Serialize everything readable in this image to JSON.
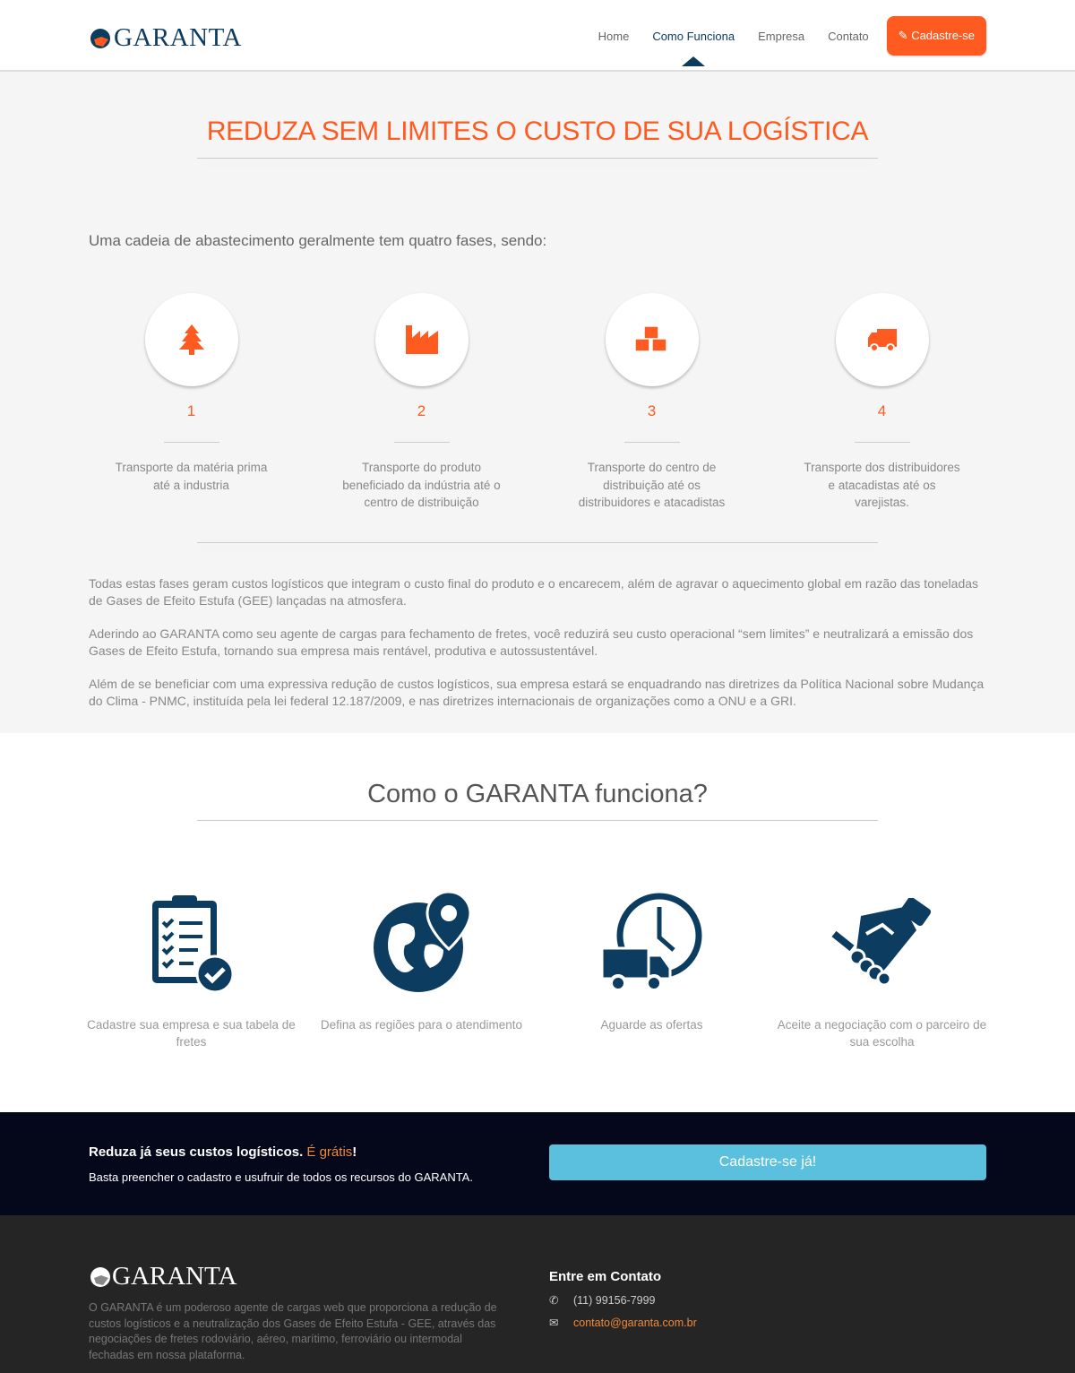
{
  "header": {
    "logo": "GARANTA",
    "nav": [
      "Home",
      "Como Funciona",
      "Empresa",
      "Contato"
    ],
    "active": "Como Funciona",
    "cta": "Cadastre-se"
  },
  "colors": {
    "accent": "#ff5a1f",
    "brand": "#0d3c61",
    "cta_button": "#5bc0de",
    "dark_band": "#05081a",
    "footer": "#252525"
  },
  "intro": {
    "title": "REDUZA SEM LIMITES O CUSTO DE SUA LOGÍSTICA",
    "lead": "Uma cadeia de abastecimento geralmente tem quatro fases, sendo:",
    "phases": [
      {
        "icon": "tree-icon",
        "num": "1",
        "text": "Transporte da matéria prima até a industria"
      },
      {
        "icon": "factory-icon",
        "num": "2",
        "text": "Transporte do produto beneficiado da indústria até o centro de distribuição"
      },
      {
        "icon": "cubes-icon",
        "num": "3",
        "text": "Transporte do centro de distribuição até os distribuidores e atacadistas"
      },
      {
        "icon": "truck-icon",
        "num": "4",
        "text": "Transporte dos distribuidores e atacadistas até os varejistas."
      }
    ],
    "paragraphs": [
      "Todas estas fases geram custos logísticos que integram o custo final do produto e o encarecem, além de agravar o aquecimento global em razão das toneladas de Gases de Efeito Estufa (GEE) lançadas na atmosfera.",
      "Aderindo ao GARANTA como seu agente de cargas para fechamento de fretes, você reduzirá seu custo operacional “sem limites” e neutralizará a emissão dos Gases de Efeito Estufa, tornando sua empresa mais rentável, produtiva e autossustentável.",
      "Além de se beneficiar com uma expressiva redução de custos logísticos, sua empresa estará se enquadrando nas diretrizes da Política Nacional sobre Mudança do Clima - PNMC, instituída pela lei federal 12.187/2009, e nas diretrizes internacionais de organizações como a ONU e a GRI."
    ]
  },
  "how": {
    "title": "Como o GARANTA funciona?",
    "steps": [
      {
        "icon": "clipboard-check-icon",
        "text": "Cadastre sua empresa e sua tabela de fretes"
      },
      {
        "icon": "globe-pin-icon",
        "text": "Defina as regiões para o atendimento"
      },
      {
        "icon": "truck-clock-icon",
        "text": "Aguarde as ofertas"
      },
      {
        "icon": "handshake-icon",
        "text": "Aceite a negociação com o parceiro de sua escolha"
      }
    ]
  },
  "cta": {
    "title": "Reduza já seus custos logísticos.",
    "highlight": "É grátis",
    "excl": "!",
    "subtitle": "Basta preencher o cadastro e usufruir de todos os recursos do GARANTA.",
    "button": "Cadastre-se já!"
  },
  "footer": {
    "logo": "GARANTA",
    "description": "O GARANTA é um poderoso agente de cargas web que proporciona a redução de custos logísticos e a neutralização dos Gases de Efeito Estufa - GEE, através das negociações de fretes rodoviário, aéreo, marítimo, ferroviário ou intermodal fechadas em nossa plataforma.",
    "contact_title": "Entre em Contato",
    "phone": "(11) 99156-7999",
    "email": "contato@garanta.com.br"
  }
}
